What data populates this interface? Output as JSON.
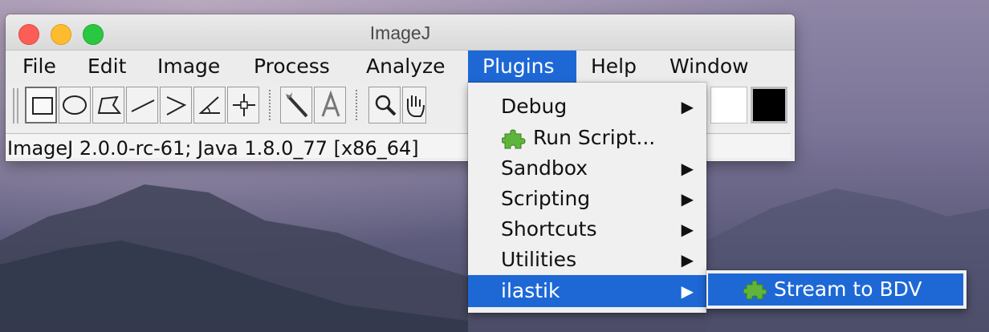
{
  "window": {
    "title": "ImageJ"
  },
  "menubar": {
    "items": [
      "File",
      "Edit",
      "Image",
      "Process",
      "Analyze",
      "Plugins",
      "Help",
      "Window"
    ],
    "active": "Plugins"
  },
  "toolbar": {
    "tools": [
      "rectangle-tool-icon",
      "oval-tool-icon",
      "polygon-tool-icon",
      "line-tool-icon",
      "angle-polyline-tool-icon",
      "angle-tool-icon",
      "point-tool-icon",
      "wand-tool-icon",
      "text-tool-icon",
      "magnifier-tool-icon",
      "hand-tool-icon"
    ],
    "foreground_color": "#ffffff",
    "background_color": "#000000"
  },
  "status": {
    "text": "ImageJ 2.0.0-rc-61; Java 1.8.0_77 [x86_64]"
  },
  "plugins_menu": {
    "items": [
      {
        "label": "Debug",
        "submenu": true
      },
      {
        "label": "Run Script...",
        "icon": "puzzle-piece-icon"
      },
      {
        "label": "Sandbox",
        "submenu": true
      },
      {
        "label": "Scripting",
        "submenu": true
      },
      {
        "label": "Shortcuts",
        "submenu": true
      },
      {
        "label": "Utilities",
        "submenu": true
      },
      {
        "label": "ilastik",
        "submenu": true
      }
    ],
    "highlighted": "ilastik"
  },
  "ilastik_submenu": {
    "items": [
      {
        "label": "Stream to BDV",
        "icon": "puzzle-piece-icon"
      }
    ]
  },
  "colors": {
    "menu_highlight": "#1e68d6",
    "close_button": "#fc5d57",
    "minimize_button": "#fdbb2e",
    "zoom_button": "#2ac840",
    "plugin_icon": "#5fb53b"
  }
}
